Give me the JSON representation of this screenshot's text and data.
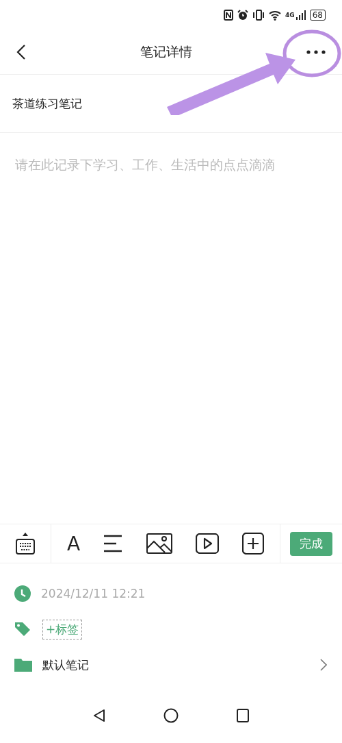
{
  "status_bar": {
    "network": "4G",
    "battery": "68"
  },
  "header": {
    "title": "笔记详情"
  },
  "note": {
    "title": "茶道练习笔记",
    "placeholder": "请在此记录下学习、工作、生活中的点点滴滴"
  },
  "toolbar": {
    "font_button": "A",
    "done_button": "完成"
  },
  "info": {
    "date": "2024/12/11 12:21",
    "tag_button": "+标签",
    "notebook": "默认笔记"
  }
}
